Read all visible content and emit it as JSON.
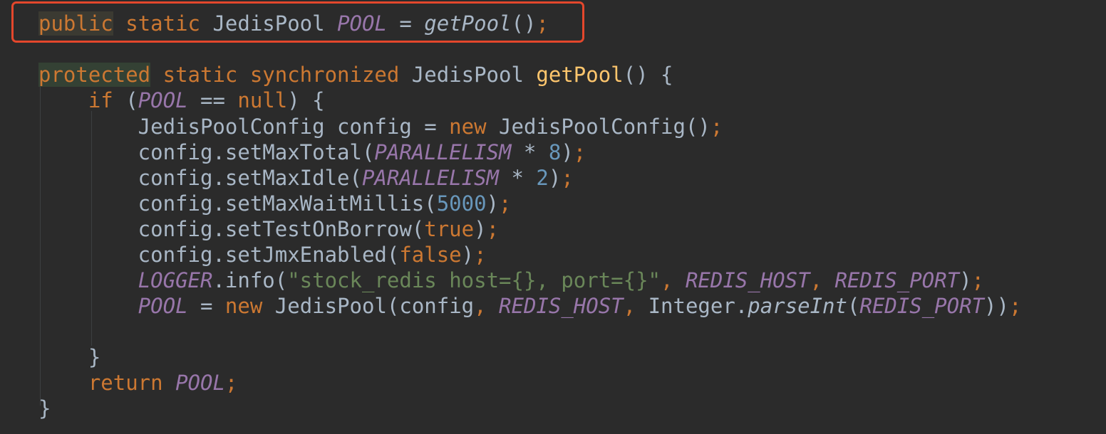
{
  "editor": {
    "language": "Java",
    "theme_colors": {
      "background": "#2b2b2b",
      "keyword": "#cc7832",
      "identifier": "#a9b7c6",
      "method_declaration": "#ffc66d",
      "static_field": "#9876aa",
      "number": "#6897bb",
      "string": "#6a8759",
      "annotation_box": "#e4472c"
    },
    "lines": [
      [
        {
          "t": "public",
          "c": "kw hl-word"
        },
        {
          "t": " ",
          "c": "plain"
        },
        {
          "t": "static",
          "c": "kw"
        },
        {
          "t": " JedisPool ",
          "c": "plain"
        },
        {
          "t": "POOL",
          "c": "field"
        },
        {
          "t": " = ",
          "c": "plain"
        },
        {
          "t": "getPool",
          "c": "italic-plain"
        },
        {
          "t": "()",
          "c": "plain"
        },
        {
          "t": ";",
          "c": "punct-semi"
        }
      ],
      [
        {
          "t": "protected",
          "c": "kw hl-word-alt"
        },
        {
          "t": " ",
          "c": "plain"
        },
        {
          "t": "static synchronized",
          "c": "kw"
        },
        {
          "t": " JedisPool ",
          "c": "plain"
        },
        {
          "t": "getPool",
          "c": "fn"
        },
        {
          "t": "() {",
          "c": "plain"
        }
      ],
      [
        {
          "t": "    ",
          "c": "plain"
        },
        {
          "t": "if",
          "c": "kw"
        },
        {
          "t": " (",
          "c": "plain"
        },
        {
          "t": "POOL",
          "c": "field"
        },
        {
          "t": " == ",
          "c": "plain"
        },
        {
          "t": "null",
          "c": "kw"
        },
        {
          "t": ") {",
          "c": "plain"
        }
      ],
      [
        {
          "t": "        JedisPoolConfig config = ",
          "c": "plain"
        },
        {
          "t": "new",
          "c": "kw"
        },
        {
          "t": " JedisPoolConfig()",
          "c": "plain"
        },
        {
          "t": ";",
          "c": "punct-semi"
        }
      ],
      [
        {
          "t": "        config.setMaxTotal(",
          "c": "plain"
        },
        {
          "t": "PARALLELISM",
          "c": "field"
        },
        {
          "t": " * ",
          "c": "plain"
        },
        {
          "t": "8",
          "c": "num"
        },
        {
          "t": ")",
          "c": "plain"
        },
        {
          "t": ";",
          "c": "punct-semi"
        }
      ],
      [
        {
          "t": "        config.setMaxIdle(",
          "c": "plain"
        },
        {
          "t": "PARALLELISM",
          "c": "field"
        },
        {
          "t": " * ",
          "c": "plain"
        },
        {
          "t": "2",
          "c": "num"
        },
        {
          "t": ")",
          "c": "plain"
        },
        {
          "t": ";",
          "c": "punct-semi"
        }
      ],
      [
        {
          "t": "        config.setMaxWaitMillis(",
          "c": "plain"
        },
        {
          "t": "5000",
          "c": "num"
        },
        {
          "t": ")",
          "c": "plain"
        },
        {
          "t": ";",
          "c": "punct-semi"
        }
      ],
      [
        {
          "t": "        config.setTestOnBorrow(",
          "c": "plain"
        },
        {
          "t": "true",
          "c": "kw"
        },
        {
          "t": ")",
          "c": "plain"
        },
        {
          "t": ";",
          "c": "punct-semi"
        }
      ],
      [
        {
          "t": "        config.setJmxEnabled(",
          "c": "plain"
        },
        {
          "t": "false",
          "c": "kw"
        },
        {
          "t": ")",
          "c": "plain"
        },
        {
          "t": ";",
          "c": "punct-semi"
        }
      ],
      [
        {
          "t": "        ",
          "c": "plain"
        },
        {
          "t": "LOGGER",
          "c": "field"
        },
        {
          "t": ".info(",
          "c": "plain"
        },
        {
          "t": "\"stock_redis host={}, port={}\"",
          "c": "str"
        },
        {
          "t": ", ",
          "c": "kw"
        },
        {
          "t": "REDIS_HOST",
          "c": "field"
        },
        {
          "t": ", ",
          "c": "kw"
        },
        {
          "t": "REDIS_PORT",
          "c": "field"
        },
        {
          "t": ")",
          "c": "plain"
        },
        {
          "t": ";",
          "c": "punct-semi"
        }
      ],
      [
        {
          "t": "        ",
          "c": "plain"
        },
        {
          "t": "POOL",
          "c": "field"
        },
        {
          "t": " = ",
          "c": "plain"
        },
        {
          "t": "new",
          "c": "kw"
        },
        {
          "t": " JedisPool(config",
          "c": "plain"
        },
        {
          "t": ", ",
          "c": "kw"
        },
        {
          "t": "REDIS_HOST",
          "c": "field"
        },
        {
          "t": ", ",
          "c": "kw"
        },
        {
          "t": "Integer.",
          "c": "plain"
        },
        {
          "t": "parseInt",
          "c": "italic-plain"
        },
        {
          "t": "(",
          "c": "plain"
        },
        {
          "t": "REDIS_PORT",
          "c": "field"
        },
        {
          "t": "))",
          "c": "plain"
        },
        {
          "t": ";",
          "c": "punct-semi"
        }
      ],
      [],
      [
        {
          "t": "    }",
          "c": "plain"
        }
      ],
      [
        {
          "t": "    ",
          "c": "plain"
        },
        {
          "t": "return",
          "c": "kw"
        },
        {
          "t": " ",
          "c": "plain"
        },
        {
          "t": "POOL",
          "c": "field"
        },
        {
          "t": ";",
          "c": "punct-semi"
        }
      ],
      [
        {
          "t": "}",
          "c": "plain"
        }
      ]
    ]
  }
}
